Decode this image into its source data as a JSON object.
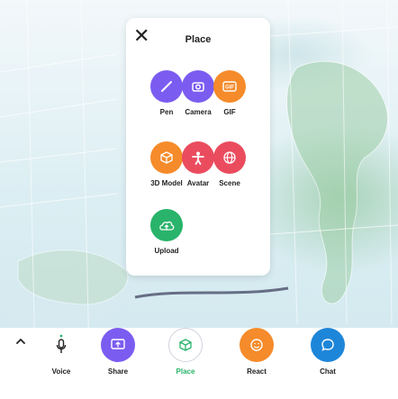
{
  "panel": {
    "title": "Place",
    "tools": [
      {
        "label": "Pen",
        "icon": "pen-icon",
        "color": "#7b5cf0"
      },
      {
        "label": "Camera",
        "icon": "camera-icon",
        "color": "#7b5cf0"
      },
      {
        "label": "GIF",
        "icon": "gif-icon",
        "color": "#f58b2a"
      },
      {
        "label": "3D Model",
        "icon": "cube-icon",
        "color": "#f58b2a"
      },
      {
        "label": "Avatar",
        "icon": "avatar-icon",
        "color": "#ea4c5e"
      },
      {
        "label": "Scene",
        "icon": "globe-icon",
        "color": "#ea4c5e"
      },
      {
        "label": "Upload",
        "icon": "cloud-upload-icon",
        "color": "#29b36b"
      }
    ]
  },
  "bottom_bar": {
    "voice_label": "Voice",
    "share_label": "Share",
    "place_label": "Place",
    "react_label": "React",
    "chat_label": "Chat",
    "colors": {
      "share": "#7b5cf0",
      "place": "#29b36b",
      "react": "#f58b2a",
      "chat": "#1e86d8"
    }
  }
}
